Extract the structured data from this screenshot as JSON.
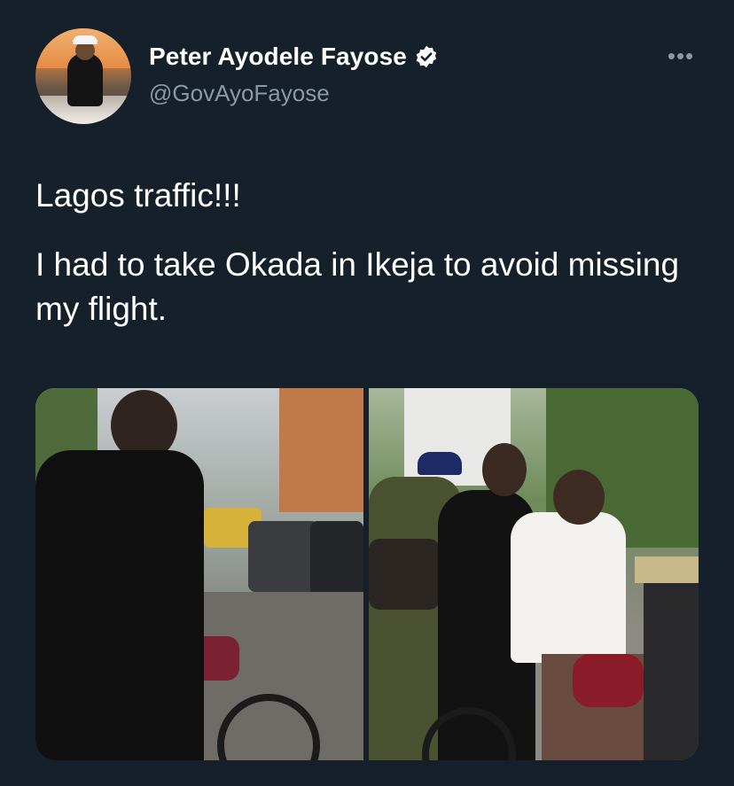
{
  "author": {
    "display_name": "Peter Ayodele Fayose",
    "handle": "@GovAyoFayose",
    "verified": true
  },
  "tweet": {
    "paragraphs": [
      "Lagos traffic!!!",
      "I had to take Okada in Ikeja to avoid missing my flight."
    ]
  },
  "menu": {
    "icon": "more-horizontal-icon",
    "label": "•••"
  },
  "media": [
    {
      "name": "photo-man-beside-motorcycle"
    },
    {
      "name": "photo-riders-on-okada"
    }
  ],
  "colors": {
    "background": "#15202b",
    "text_primary": "#ffffff",
    "text_secondary": "#8b98a5",
    "verified_badge": "#ffffff"
  }
}
